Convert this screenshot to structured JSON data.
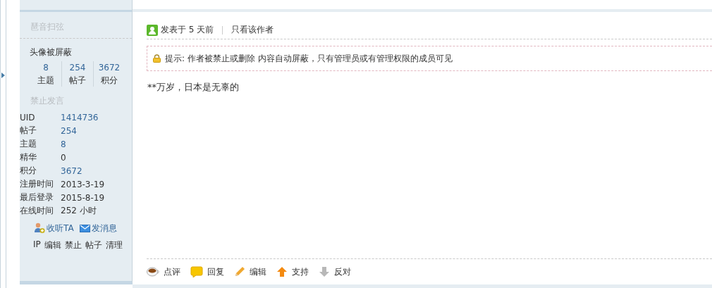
{
  "sidebar": {
    "user_group": "琶音扫弦",
    "avatar_notice": "头像被屏蔽",
    "stats": [
      {
        "value": "8",
        "label": "主题"
      },
      {
        "value": "254",
        "label": "帖子"
      },
      {
        "value": "3672",
        "label": "积分"
      }
    ],
    "status": "禁止发言",
    "profile": [
      {
        "label": "UID",
        "value": "1414736",
        "link": true
      },
      {
        "label": "帖子",
        "value": "254",
        "link": true
      },
      {
        "label": "主题",
        "value": "8",
        "link": true
      },
      {
        "label": "精华",
        "value": "0",
        "link": false
      },
      {
        "label": "积分",
        "value": "3672",
        "link": true
      },
      {
        "label": "注册时间",
        "value": "2013-3-19",
        "link": false
      },
      {
        "label": "最后登录",
        "value": "2015-8-19",
        "link": false
      },
      {
        "label": "在线时间",
        "value": "252 小时",
        "link": false
      }
    ],
    "actions": [
      {
        "kind": "follow",
        "label": "收听TA"
      },
      {
        "kind": "message",
        "label": "发消息"
      }
    ],
    "admin_links": [
      "IP",
      "编辑",
      "禁止",
      "帖子",
      "清理"
    ]
  },
  "post": {
    "posted": "发表于 5 天前",
    "author_only": "只看该作者",
    "notice": "提示: 作者被禁止或删除 内容自动屏蔽，只有管理员或有管理权限的成员可见",
    "content": "**万岁，日本是无辜的",
    "footer_actions": [
      {
        "kind": "comment",
        "label": "点评"
      },
      {
        "kind": "reply",
        "label": "回复"
      },
      {
        "kind": "edit",
        "label": "编辑"
      },
      {
        "kind": "support",
        "label": "支持"
      },
      {
        "kind": "oppose",
        "label": "反对"
      }
    ]
  }
}
